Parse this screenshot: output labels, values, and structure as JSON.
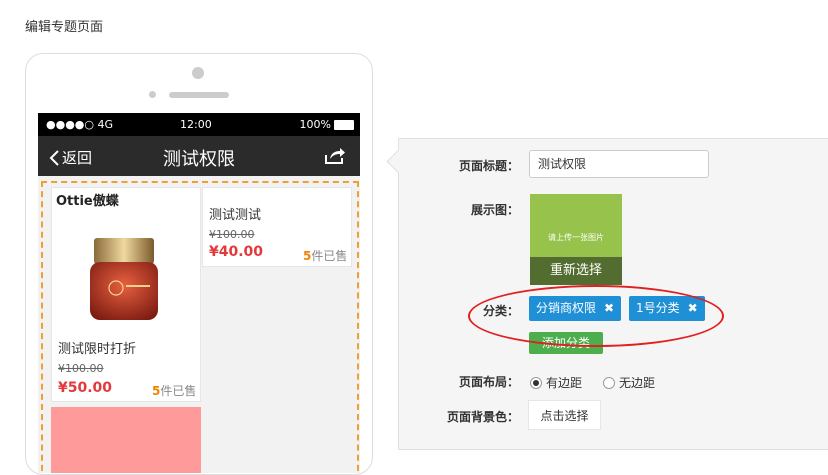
{
  "page": {
    "title": "编辑专题页面"
  },
  "preview": {
    "status": {
      "signal": "●●●●○ 4G",
      "time": "12:00",
      "battery": "100%"
    },
    "nav": {
      "back": "返回",
      "title": "测试权限"
    },
    "products": [
      {
        "brand": "Ottie傲蝶",
        "name": "测试限时打折",
        "old_price": "¥100.00",
        "price": "¥50.00",
        "sold_count": "5",
        "sold_suffix": "件已售"
      },
      {
        "name": "测试测试",
        "old_price": "¥100.00",
        "price": "¥40.00",
        "sold_count": "5",
        "sold_suffix": "件已售"
      }
    ]
  },
  "form": {
    "title_label": "页面标题：",
    "title_value": "测试权限",
    "image_label": "展示图：",
    "image_placeholder": "请上传一张图片",
    "reselect": "重新选择",
    "category_label": "分类：",
    "tags": [
      "分销商权限",
      "1号分类"
    ],
    "add_category": "添加分类",
    "layout_label": "页面布局：",
    "layout_options": [
      "有边距",
      "无边距"
    ],
    "layout_selected": "有边距",
    "bg_label": "页面背景色：",
    "bg_button": "点击选择"
  },
  "colors": {
    "accent_blue": "#1f8fd6",
    "green": "#4cae4c",
    "price_red": "#e4393c",
    "annotation_red": "#e02020"
  }
}
